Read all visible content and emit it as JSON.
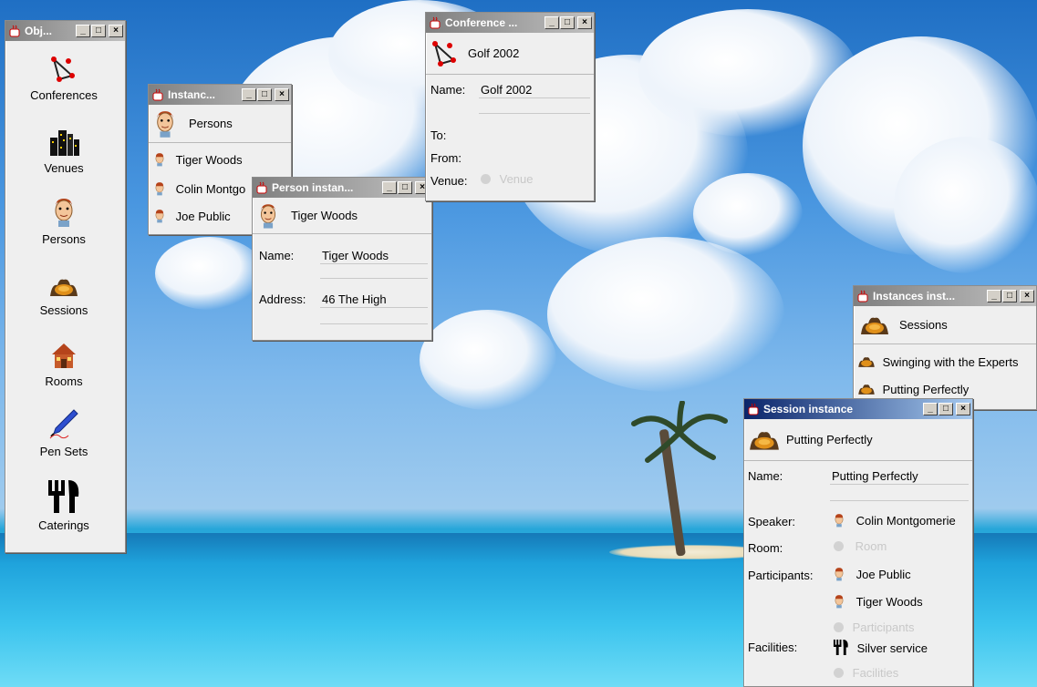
{
  "object_window": {
    "title": "Obj...",
    "items": [
      {
        "label": "Conferences",
        "icon": "conference-icon"
      },
      {
        "label": "Venues",
        "icon": "venue-building-icon"
      },
      {
        "label": "Persons",
        "icon": "person-icon"
      },
      {
        "label": "Sessions",
        "icon": "session-icon"
      },
      {
        "label": "Rooms",
        "icon": "house-icon"
      },
      {
        "label": "Pen Sets",
        "icon": "pen-icon"
      },
      {
        "label": "Caterings",
        "icon": "fork-knife-icon"
      }
    ]
  },
  "persons_instances_window": {
    "title": "Instanc...",
    "header": "Persons",
    "items": [
      "Tiger Woods",
      "Colin Montgo",
      "Joe Public"
    ]
  },
  "person_instance_window": {
    "title": "Person instan...",
    "header": "Tiger Woods",
    "name_label": "Name:",
    "name_value": "Tiger Woods",
    "address_label": "Address:",
    "address_value": "46 The High"
  },
  "conference_window": {
    "title": "Conference ...",
    "header": "Golf 2002",
    "name_label": "Name:",
    "name_value": "Golf 2002",
    "to_label": "To:",
    "from_label": "From:",
    "venue_label": "Venue:",
    "venue_placeholder": "Venue"
  },
  "sessions_instances_window": {
    "title": "Instances inst...",
    "header": "Sessions",
    "items": [
      "Swinging with the Experts",
      "Putting Perfectly"
    ]
  },
  "session_instance_window": {
    "title": "Session instance",
    "header": "Putting Perfectly",
    "name_label": "Name:",
    "name_value": "Putting Perfectly",
    "speaker_label": "Speaker:",
    "speaker_value": "Colin Montgomerie",
    "room_label": "Room:",
    "room_placeholder": "Room",
    "participants_label": "Participants:",
    "participants": [
      "Joe Public",
      "Tiger Woods"
    ],
    "participants_placeholder": "Participants",
    "facilities_label": "Facilities:",
    "facilities_value": "Silver service",
    "facilities_placeholder": "Facilities"
  },
  "titlebar_buttons": {
    "minimize": "_",
    "maximize": "□",
    "close": "×"
  }
}
